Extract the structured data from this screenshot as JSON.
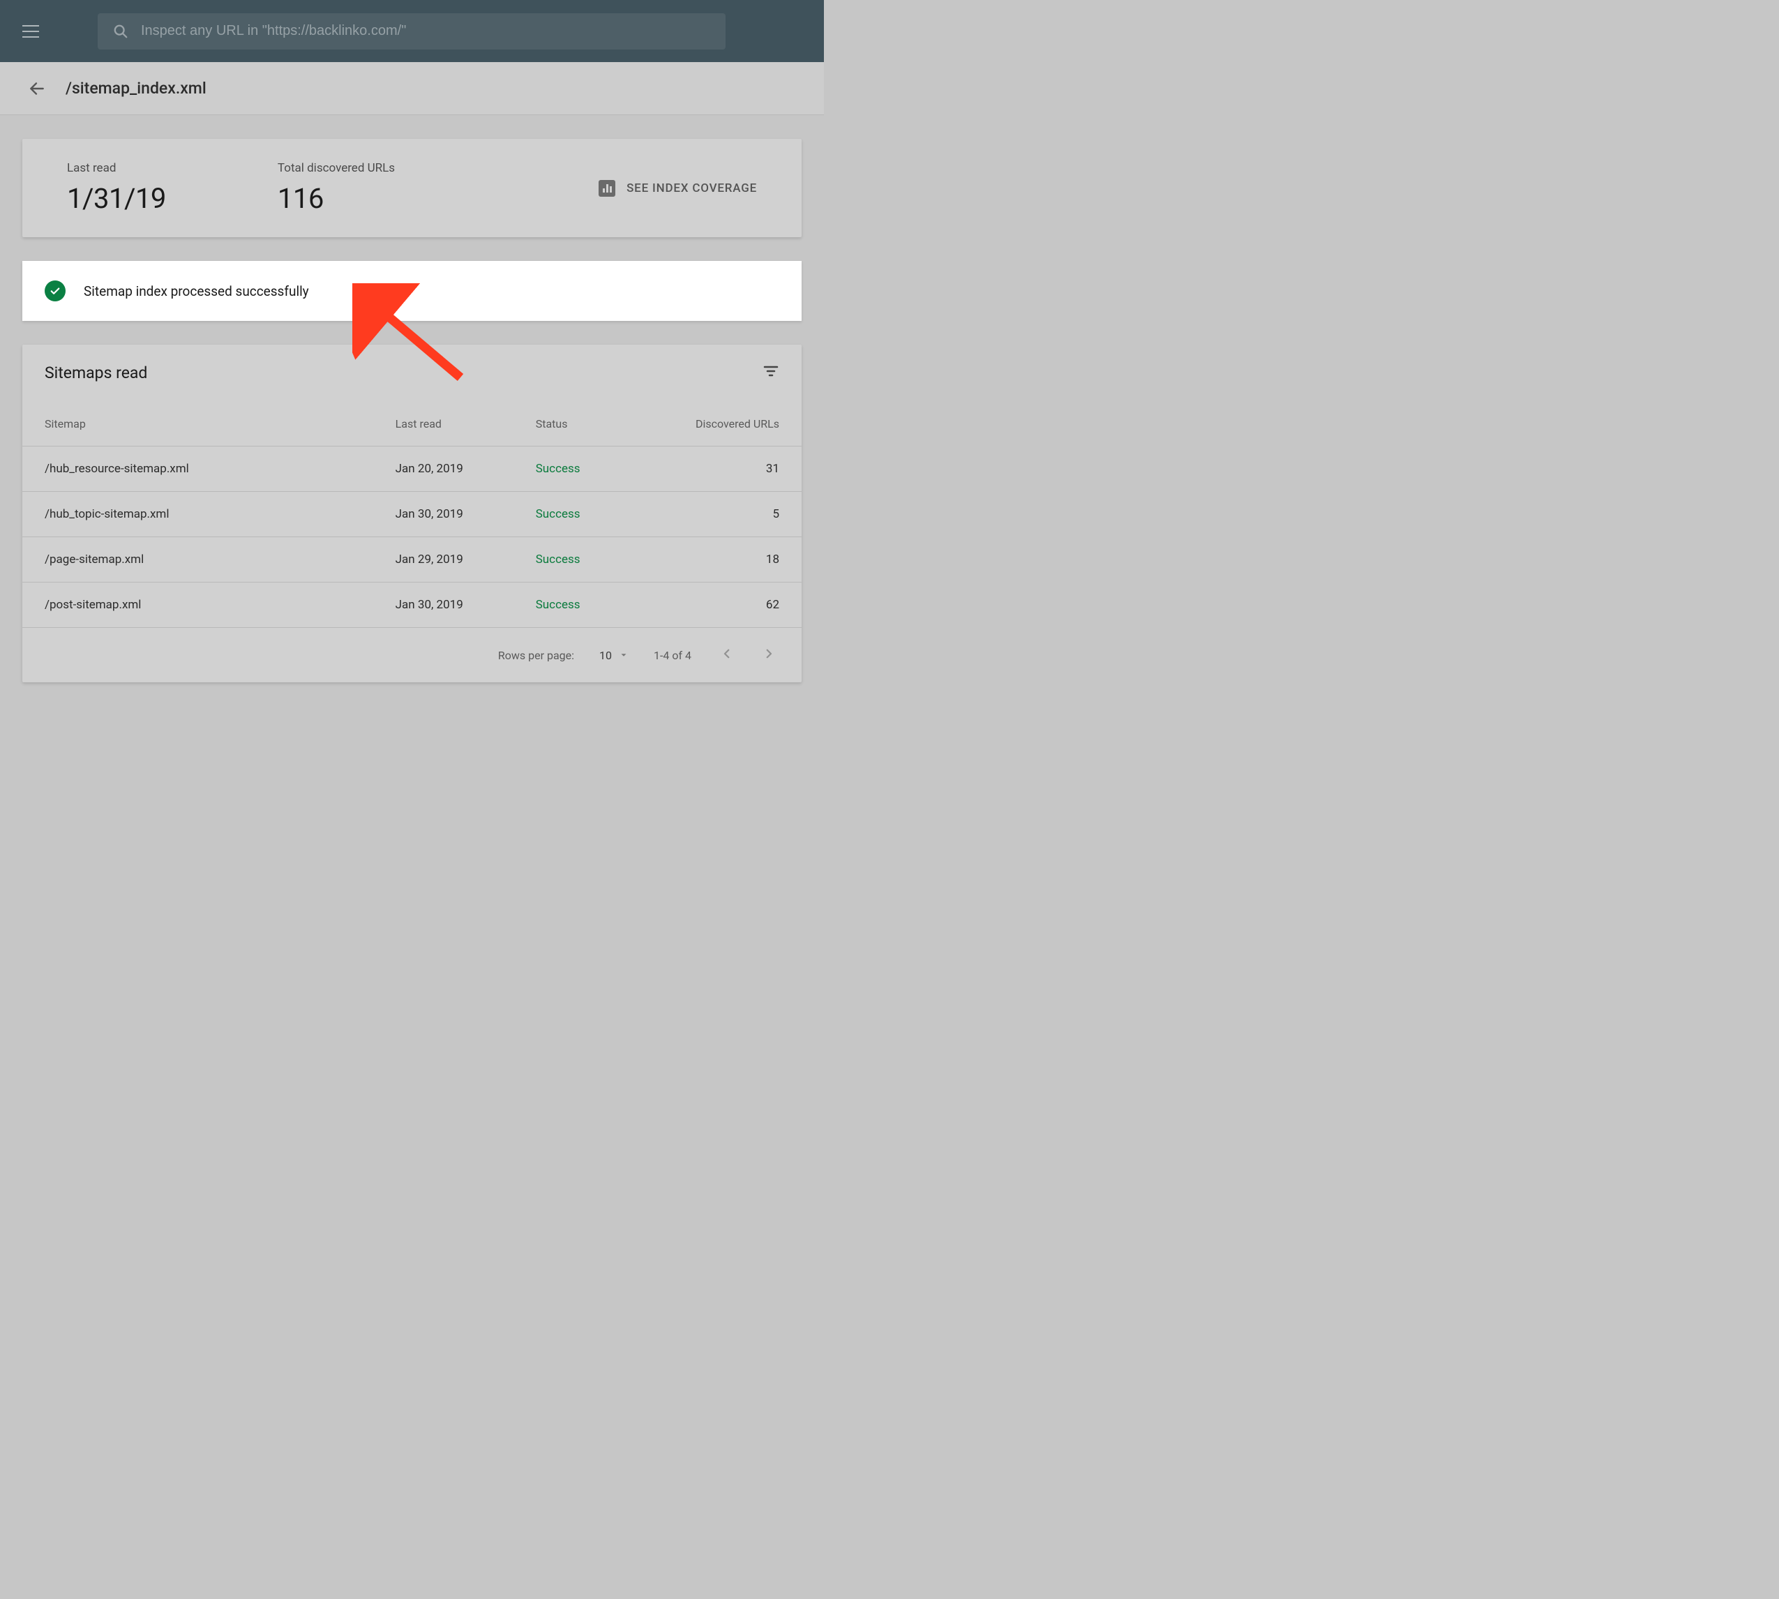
{
  "topbar": {
    "search_placeholder": "Inspect any URL in \"https://backlinko.com/\""
  },
  "titlebar": {
    "page_title": "/sitemap_index.xml"
  },
  "stats": {
    "last_read_label": "Last read",
    "last_read_value": "1/31/19",
    "total_urls_label": "Total discovered URLs",
    "total_urls_value": "116",
    "coverage_label": "SEE INDEX COVERAGE"
  },
  "status": {
    "message": "Sitemap index processed successfully"
  },
  "table": {
    "title": "Sitemaps read",
    "columns": {
      "sitemap": "Sitemap",
      "last_read": "Last read",
      "status": "Status",
      "discovered": "Discovered URLs"
    },
    "rows": [
      {
        "sitemap": "/hub_resource-sitemap.xml",
        "last_read": "Jan 20, 2019",
        "status": "Success",
        "discovered": "31"
      },
      {
        "sitemap": "/hub_topic-sitemap.xml",
        "last_read": "Jan 30, 2019",
        "status": "Success",
        "discovered": "5"
      },
      {
        "sitemap": "/page-sitemap.xml",
        "last_read": "Jan 29, 2019",
        "status": "Success",
        "discovered": "18"
      },
      {
        "sitemap": "/post-sitemap.xml",
        "last_read": "Jan 30, 2019",
        "status": "Success",
        "discovered": "62"
      }
    ]
  },
  "pager": {
    "rows_label": "Rows per page:",
    "rows_value": "10",
    "range": "1-4 of 4"
  },
  "colors": {
    "success": "#0c7b3e",
    "check_bg": "#0b8043",
    "arrow": "#ff3b1f"
  }
}
